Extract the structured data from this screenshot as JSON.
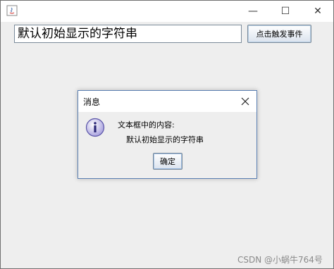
{
  "window": {
    "controls": {
      "minimize": "—",
      "maximize": "☐",
      "close": "✕"
    }
  },
  "main": {
    "textfield_value": "默认初始显示的字符串",
    "trigger_button_label": "点击触发事件"
  },
  "dialog": {
    "title": "消息",
    "message_label": "文本框中的内容:",
    "message_value": "默认初始显示的字符串",
    "ok_label": "确定"
  },
  "watermark": "CSDN @小蜗牛764号",
  "colors": {
    "window_bg": "#eeeeee",
    "titlebar_bg": "#ffffff",
    "dialog_border": "#5a7fb2",
    "info_icon_fill": "#b9b3e6",
    "info_icon_stroke": "#5a54a8"
  }
}
